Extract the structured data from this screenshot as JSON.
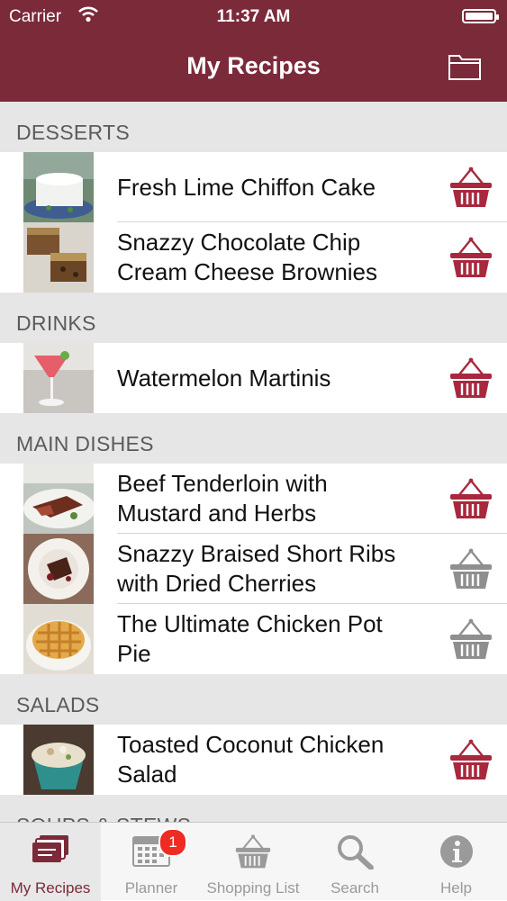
{
  "status": {
    "carrier": "Carrier",
    "time": "11:37 AM"
  },
  "header": {
    "title": "My Recipes"
  },
  "sections": [
    {
      "title": "DESSERTS",
      "rows": [
        {
          "title": "Fresh Lime Chiffon Cake",
          "in_list": true
        },
        {
          "title": "Snazzy Chocolate Chip Cream Cheese Brownies",
          "in_list": true
        }
      ]
    },
    {
      "title": "DRINKS",
      "rows": [
        {
          "title": "Watermelon Martinis",
          "in_list": true
        }
      ]
    },
    {
      "title": "MAIN DISHES",
      "rows": [
        {
          "title": "Beef Tenderloin with Mustard and Herbs",
          "in_list": true
        },
        {
          "title": "Snazzy Braised Short Ribs with Dried Cherries",
          "in_list": false
        },
        {
          "title": "The Ultimate Chicken Pot Pie",
          "in_list": false
        }
      ]
    },
    {
      "title": "SALADS",
      "rows": [
        {
          "title": "Toasted Coconut Chicken Salad",
          "in_list": true
        }
      ]
    },
    {
      "title": "SOUPS & STEWS",
      "rows": []
    }
  ],
  "tabs": [
    {
      "label": "My Recipes",
      "icon": "recipes-icon",
      "active": true
    },
    {
      "label": "Planner",
      "icon": "calendar-icon",
      "badge": "1"
    },
    {
      "label": "Shopping List",
      "icon": "basket-icon"
    },
    {
      "label": "Search",
      "icon": "search-icon"
    },
    {
      "label": "Help",
      "icon": "info-icon"
    }
  ],
  "colors": {
    "brand": "#7b2a3a",
    "basket_active": "#a8283e",
    "basket_inactive": "#8f8f8f",
    "section_bg": "#e6e6e6",
    "badge": "#ee2c24"
  }
}
